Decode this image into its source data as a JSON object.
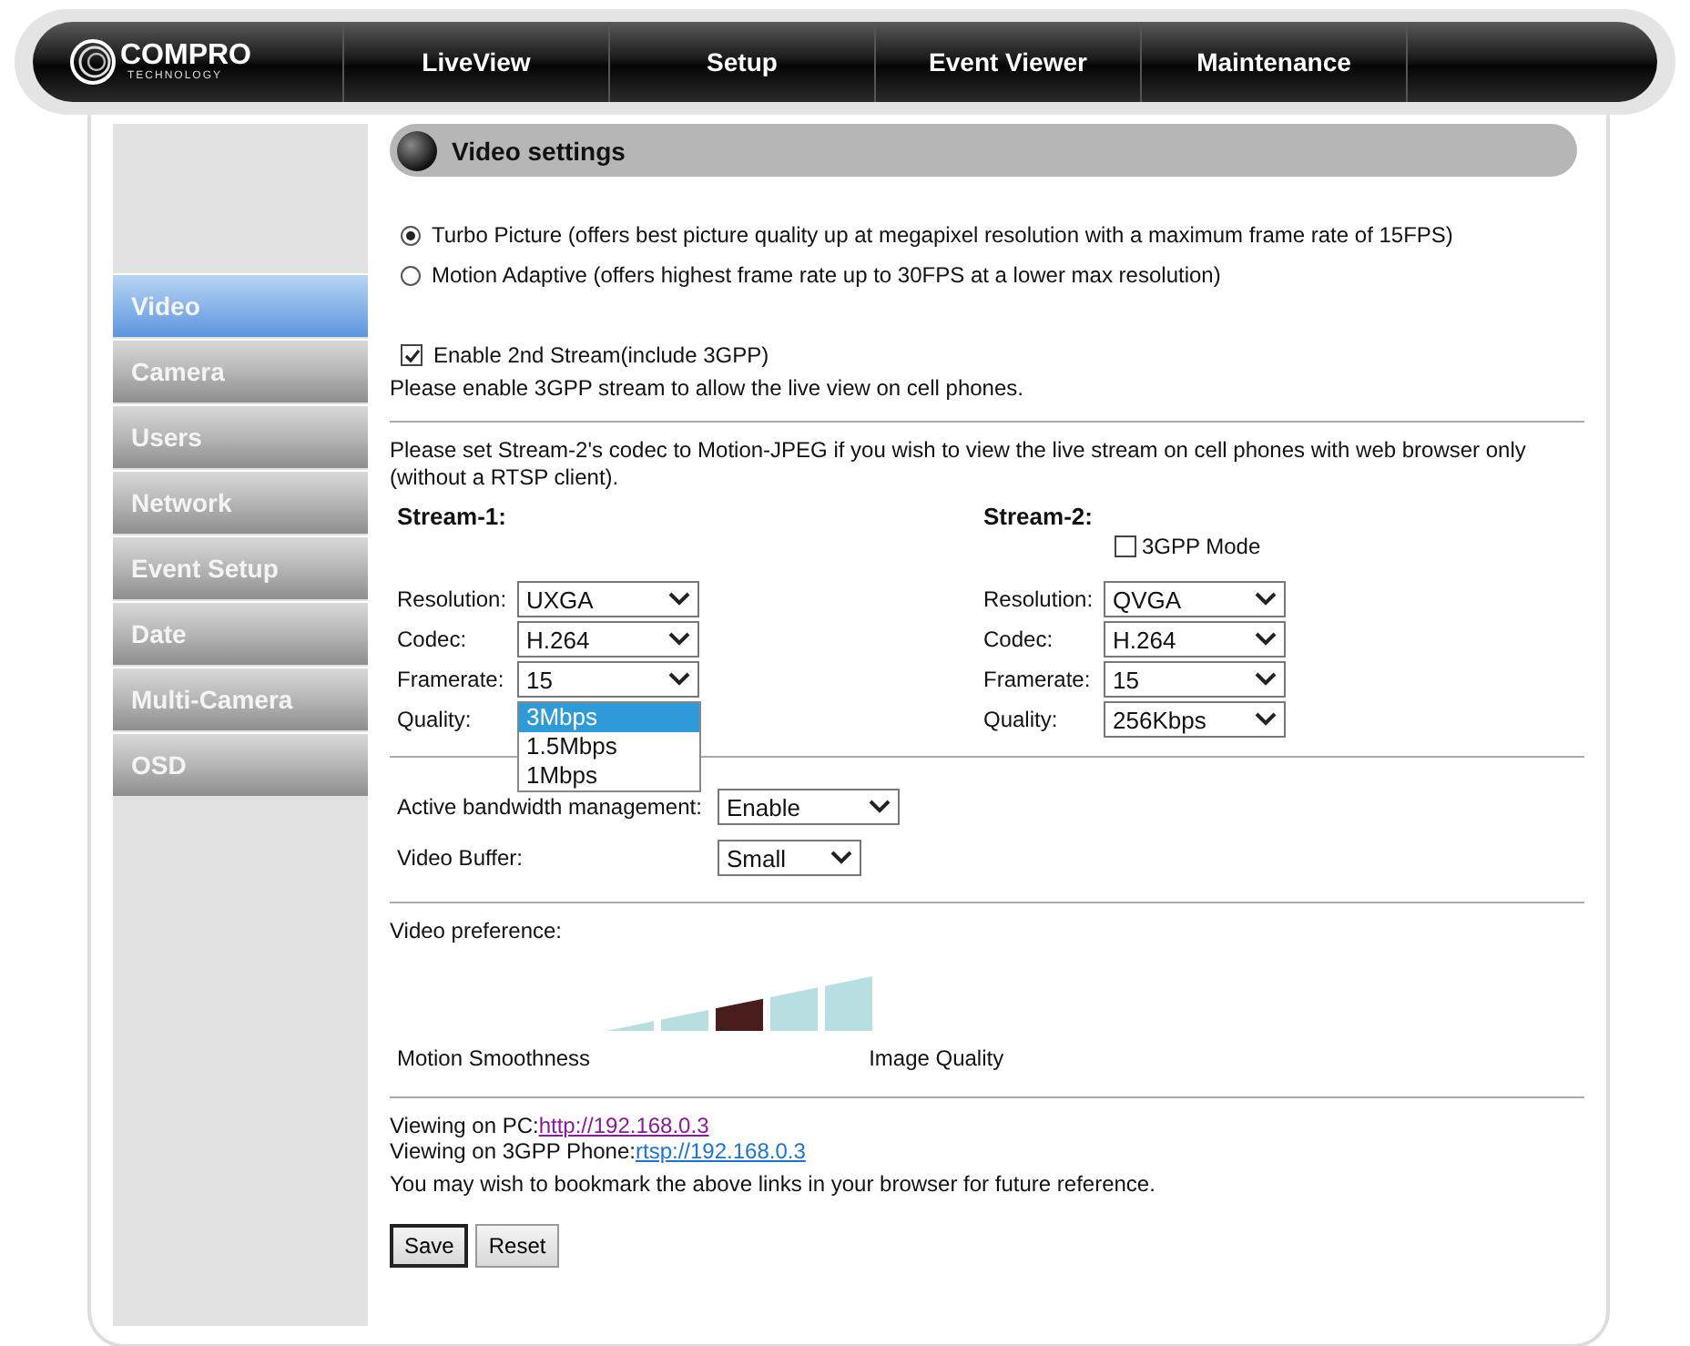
{
  "nav": {
    "logo": {
      "name": "COMPRO",
      "sub": "TECHNOLOGY"
    },
    "items": [
      {
        "label": "LiveView"
      },
      {
        "label": "Setup"
      },
      {
        "label": "Event Viewer"
      },
      {
        "label": "Maintenance"
      }
    ]
  },
  "sidebar": {
    "items": [
      {
        "label": "Video",
        "selected": true
      },
      {
        "label": "Camera",
        "selected": false
      },
      {
        "label": "Users",
        "selected": false
      },
      {
        "label": "Network",
        "selected": false
      },
      {
        "label": "Event Setup",
        "selected": false
      },
      {
        "label": "Date",
        "selected": false
      },
      {
        "label": "Multi-Camera",
        "selected": false
      },
      {
        "label": "OSD",
        "selected": false
      }
    ]
  },
  "section_title": "Video settings",
  "picture_modes": [
    {
      "label": "Turbo Picture (offers best picture quality up at megapixel resolution with a maximum frame rate of 15FPS)",
      "selected": true
    },
    {
      "label": "Motion Adaptive (offers highest frame rate up to 30FPS at a lower max resolution)",
      "selected": false
    }
  ],
  "second_stream": {
    "label": "Enable 2nd Stream(include 3GPP)",
    "checked": true
  },
  "second_stream_note": "Please enable 3GPP stream to allow the live view on cell phones.",
  "codec_note": "Please set Stream-2's codec to Motion-JPEG if you wish to view the live stream on cell phones with web browser only (without a RTSP client).",
  "streams": [
    {
      "title": "Stream-1:",
      "fields": [
        {
          "label": "Resolution:",
          "value": "UXGA",
          "expanded": false
        },
        {
          "label": "Codec:",
          "value": "H.264",
          "expanded": false
        },
        {
          "label": "Framerate:",
          "value": "15",
          "expanded": false
        },
        {
          "label": "Quality:",
          "expanded": true,
          "options": [
            {
              "label": "3Mbps",
              "selected": true
            },
            {
              "label": "1.5Mbps",
              "selected": false
            },
            {
              "label": "1Mbps",
              "selected": false
            }
          ]
        }
      ]
    },
    {
      "title": "Stream-2:",
      "mode": {
        "label": "3GPP Mode",
        "checked": false
      },
      "fields": [
        {
          "label": "Resolution:",
          "value": "QVGA",
          "expanded": false
        },
        {
          "label": "Codec:",
          "value": "H.264",
          "expanded": false
        },
        {
          "label": "Framerate:",
          "value": "15",
          "expanded": false
        },
        {
          "label": "Quality:",
          "value": "256Kbps",
          "expanded": false
        }
      ]
    }
  ],
  "bandwidth": {
    "label": "Active bandwidth management:",
    "value": "Enable"
  },
  "video_buffer": {
    "label": "Video Buffer:",
    "value": "Small"
  },
  "video_preference": {
    "label": "Video preference:",
    "bars": [
      {
        "selected": false
      },
      {
        "selected": false
      },
      {
        "selected": true
      },
      {
        "selected": false
      },
      {
        "selected": false
      }
    ],
    "left_label": "Motion Smoothness",
    "right_label": "Image Quality"
  },
  "links": [
    {
      "label": "Viewing on PC:",
      "url": "http://192.168.0.3",
      "visited": true
    },
    {
      "label": "Viewing on 3GPP Phone:",
      "url": "rtsp://192.168.0.3",
      "visited": false
    }
  ],
  "bookmark_note": "You may wish to bookmark the above links in your browser for future reference.",
  "buttons": [
    {
      "label": "Save",
      "default": true
    },
    {
      "label": "Reset",
      "default": false
    }
  ]
}
